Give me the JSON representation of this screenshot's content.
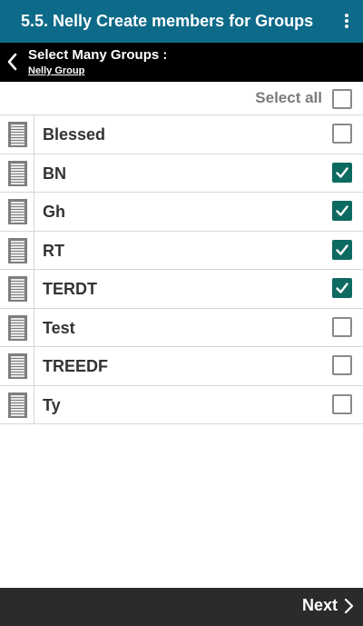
{
  "header": {
    "title": "5.5. Nelly Create members for Groups",
    "menu_icon": "more-vertical-icon"
  },
  "subheader": {
    "title": "Select Many Groups :",
    "caption": "Nelly Group",
    "back_icon": "chevron-left-icon"
  },
  "select_all": {
    "label": "Select all",
    "checked": false
  },
  "groups": [
    {
      "name": "Blessed",
      "checked": false
    },
    {
      "name": "BN",
      "checked": true
    },
    {
      "name": "Gh",
      "checked": true
    },
    {
      "name": "RT",
      "checked": true
    },
    {
      "name": "TERDT",
      "checked": true
    },
    {
      "name": "Test",
      "checked": false
    },
    {
      "name": "TREEDF",
      "checked": false
    },
    {
      "name": "Ty",
      "checked": false
    }
  ],
  "footer": {
    "next_label": "Next",
    "next_icon": "chevron-right-icon"
  },
  "colors": {
    "header_bg": "#0d6a89",
    "checkbox_checked": "#0d6a61",
    "footer_bg": "#2b2b2b"
  }
}
